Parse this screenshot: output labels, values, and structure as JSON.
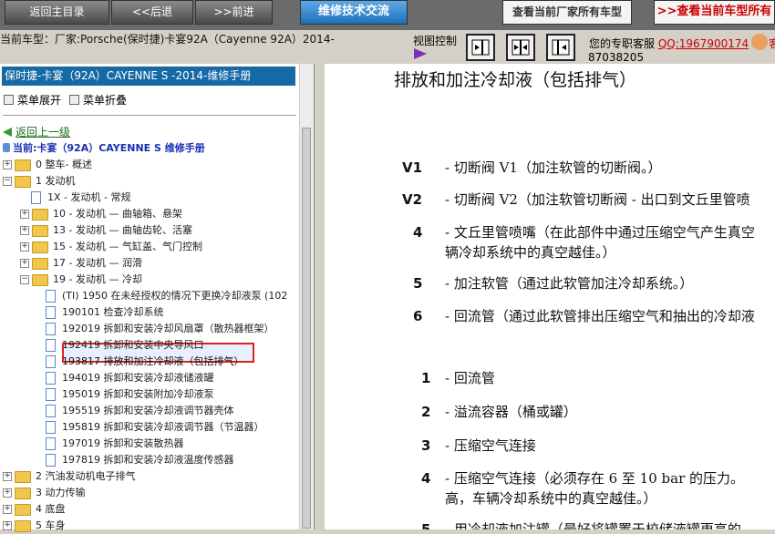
{
  "toolbar": {
    "home": "返回主目录",
    "back": "<<后退",
    "forward": ">>前进",
    "tech": "维修技术交流",
    "all_models": "查看当前厂家所有车型",
    "view_all": ">>查看当前车型所有"
  },
  "infobar": {
    "current_model": "当前车型：厂家:Porsche(保时捷)卡宴92A（Cayenne 92A）2014-",
    "view_control": "视图控制",
    "service_label": "您的专职客服",
    "qq": "QQ:1967900174",
    "phone": "87038205",
    "extra": "客"
  },
  "left": {
    "header": "保时捷-卡宴（92A）CAYENNE S -2014-维修手册",
    "expand": "菜单展开",
    "collapse": "菜单折叠",
    "back_up": "返回上一级",
    "current": "当前:卡宴（92A）CAYENNE S 维修手册",
    "tree": [
      {
        "pm": "+",
        "icon": "folder",
        "label": "0 整车- 概述"
      },
      {
        "pm": "-",
        "icon": "folder",
        "label": "1 发动机"
      },
      {
        "pm": "",
        "icon": "doc",
        "label": "1X - 发动机 - 常规"
      },
      {
        "pm": "+",
        "icon": "folder",
        "label": "10 - 发动机 — 曲轴箱、悬架"
      },
      {
        "pm": "+",
        "icon": "folder",
        "label": "13 - 发动机 — 曲轴齿轮、活塞"
      },
      {
        "pm": "+",
        "icon": "folder",
        "label": "15 - 发动机 — 气缸盖、气门控制"
      },
      {
        "pm": "+",
        "icon": "folder",
        "label": "17 - 发动机 — 润滑"
      },
      {
        "pm": "-",
        "icon": "folder",
        "label": "19 - 发动机 — 冷却"
      },
      {
        "pm": "",
        "icon": "doc",
        "label": "(TI) 1950 在未经授权的情况下更换冷却液泵 (102"
      },
      {
        "pm": "",
        "icon": "doc",
        "label": "190101 检查冷却系统"
      },
      {
        "pm": "",
        "icon": "doc",
        "label": "192019 拆卸和安装冷却风扇罩（散热器框架）"
      },
      {
        "pm": "",
        "icon": "doc",
        "label": "192419 拆卸和安装中央导风口"
      },
      {
        "pm": "",
        "icon": "doc",
        "label": "193817 排放和加注冷却液（包括排气）"
      },
      {
        "pm": "",
        "icon": "doc",
        "label": "194019 拆卸和安装冷却液储液罐"
      },
      {
        "pm": "",
        "icon": "doc",
        "label": "195019 拆卸和安装附加冷却液泵"
      },
      {
        "pm": "",
        "icon": "doc",
        "label": "195519 拆卸和安装冷却液调节器壳体"
      },
      {
        "pm": "",
        "icon": "doc",
        "label": "195819 拆卸和安装冷却液调节器（节温器）"
      },
      {
        "pm": "",
        "icon": "doc",
        "label": "197019 拆卸和安装散热器"
      },
      {
        "pm": "",
        "icon": "doc",
        "label": "197819 拆卸和安装冷却液温度传感器"
      },
      {
        "pm": "+",
        "icon": "folder",
        "label": "2 汽油发动机电子排气"
      },
      {
        "pm": "+",
        "icon": "folder",
        "label": "3 动力传输"
      },
      {
        "pm": "+",
        "icon": "folder",
        "label": "4 底盘"
      },
      {
        "pm": "+",
        "icon": "folder",
        "label": "5 车身"
      }
    ]
  },
  "right": {
    "title": "排放和加注冷却液（包括排气）",
    "items1": [
      {
        "key": "V1",
        "text": "- 切断阀  V1（加注软管的切断阀。）"
      },
      {
        "key": "V2",
        "text": "- 切断阀  V2（加注软管切断阀 - 出口到文丘里管喷"
      },
      {
        "key": "4",
        "text": "- 文丘里管喷嘴（在此部件中通过压缩空气产生真空",
        "text2": "辆冷却系统中的真空越佳。）"
      },
      {
        "key": "5",
        "text": "- 加注软管（通过此软管加注冷却系统。）"
      },
      {
        "key": "6",
        "text": "- 回流管（通过此软管排出压缩空气和抽出的冷却液"
      }
    ],
    "items2": [
      {
        "key": "1",
        "text": "- 回流管"
      },
      {
        "key": "2",
        "text": "- 溢流容器（桶或罐）"
      },
      {
        "key": "3",
        "text": "- 压缩空气连接"
      },
      {
        "key": "4",
        "text": "- 压缩空气连接（必须存在  6 至  10 bar 的压力。",
        "text2": "高，车辆冷却系统中的真空越佳。）"
      },
      {
        "key": "5",
        "text": "- 用冷却液加注罐（最好将罐置于校储液罐更高的"
      }
    ]
  }
}
